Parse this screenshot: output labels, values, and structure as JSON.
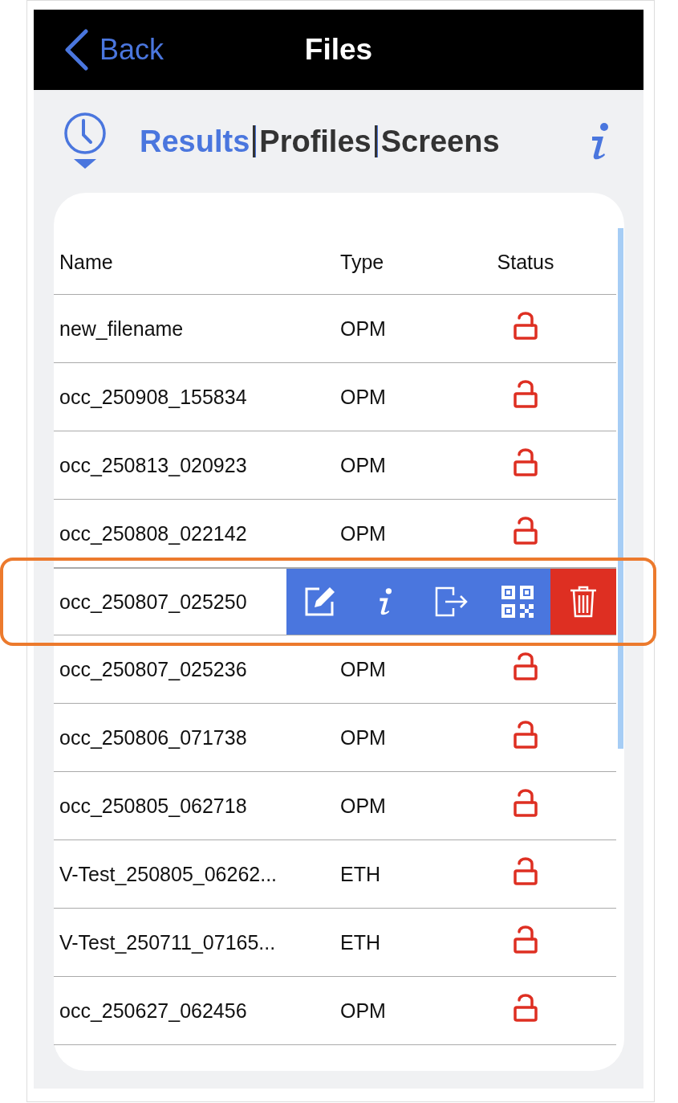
{
  "header": {
    "back": "Back",
    "title": "Files"
  },
  "tabs": [
    {
      "label": "Results",
      "selected": true
    },
    {
      "label": "Profiles",
      "selected": false
    },
    {
      "label": "Screens",
      "selected": false
    }
  ],
  "table": {
    "columns": [
      "Name",
      "Type",
      "Status"
    ],
    "rows": [
      {
        "name": "new_filename",
        "type": "OPM",
        "locked": false,
        "swiped": false
      },
      {
        "name": "occ_250908_155834",
        "type": "OPM",
        "locked": false,
        "swiped": false
      },
      {
        "name": "occ_250813_020923",
        "type": "OPM",
        "locked": false,
        "swiped": false
      },
      {
        "name": "occ_250808_022142",
        "type": "OPM",
        "locked": false,
        "swiped": false
      },
      {
        "name": "occ_250807_025250",
        "swiped": true,
        "highlighted": true
      },
      {
        "name": "occ_250807_025236",
        "type": "OPM",
        "locked": false,
        "swiped": false
      },
      {
        "name": "occ_250806_071738",
        "type": "OPM",
        "locked": false,
        "swiped": false
      },
      {
        "name": "occ_250805_062718",
        "type": "OPM",
        "locked": false,
        "swiped": false
      },
      {
        "name": "V-Test_250805_06262...",
        "type": "ETH",
        "locked": false,
        "swiped": false
      },
      {
        "name": "V-Test_250711_07165...",
        "type": "ETH",
        "locked": false,
        "swiped": false
      },
      {
        "name": "occ_250627_062456",
        "type": "OPM",
        "locked": false,
        "swiped": false
      }
    ]
  }
}
